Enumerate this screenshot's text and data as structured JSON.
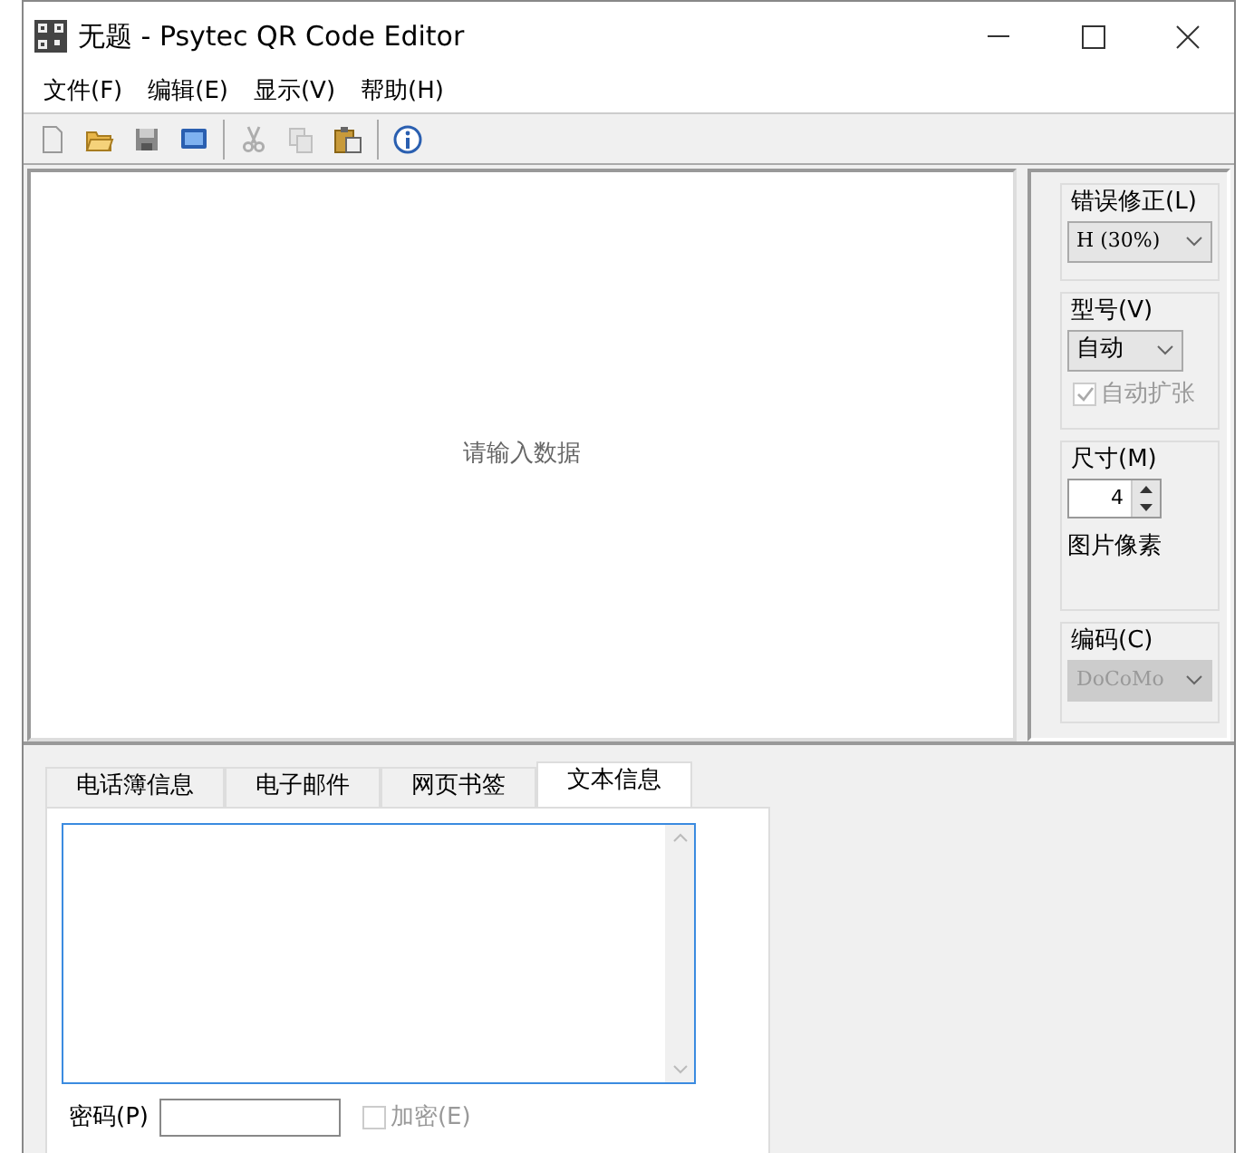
{
  "window": {
    "title": "无题 - Psytec QR Code Editor"
  },
  "menu": [
    {
      "label": "文件(F)"
    },
    {
      "label": "编辑(E)"
    },
    {
      "label": "显示(V)"
    },
    {
      "label": "帮助(H)"
    }
  ],
  "toolbar": [
    [
      {
        "kind": "new",
        "disabled": false
      },
      {
        "kind": "open",
        "disabled": false
      },
      {
        "kind": "save",
        "disabled": false
      },
      {
        "kind": "preview",
        "disabled": false
      }
    ],
    [
      {
        "kind": "cut",
        "disabled": true
      },
      {
        "kind": "copy",
        "disabled": true
      },
      {
        "kind": "paste",
        "disabled": false
      }
    ],
    [
      {
        "kind": "about",
        "disabled": false
      }
    ]
  ],
  "preview": {
    "message": "请输入数据"
  },
  "options": {
    "error_correction": {
      "label": "错误修正(L)",
      "value": "H (30%)"
    },
    "model": {
      "label": "型号(V)",
      "value": "自动",
      "auto_expand": {
        "label": "自动扩张",
        "checked": true,
        "disabled": true
      }
    },
    "size": {
      "label": "尺寸(M)",
      "value": "4",
      "unit": "图片像素"
    },
    "encoding": {
      "label": "编码(C)",
      "value": "DoCoMo",
      "disabled": true
    }
  },
  "tabs": [
    {
      "label": "电话簿信息",
      "selected": false
    },
    {
      "label": "电子邮件",
      "selected": false
    },
    {
      "label": "网页书签",
      "selected": false
    },
    {
      "label": "文本信息",
      "selected": true
    }
  ],
  "text_info": {
    "password_label": "密码(P)",
    "encrypt": {
      "label": "加密(E)",
      "checked": false,
      "disabled": true
    }
  }
}
